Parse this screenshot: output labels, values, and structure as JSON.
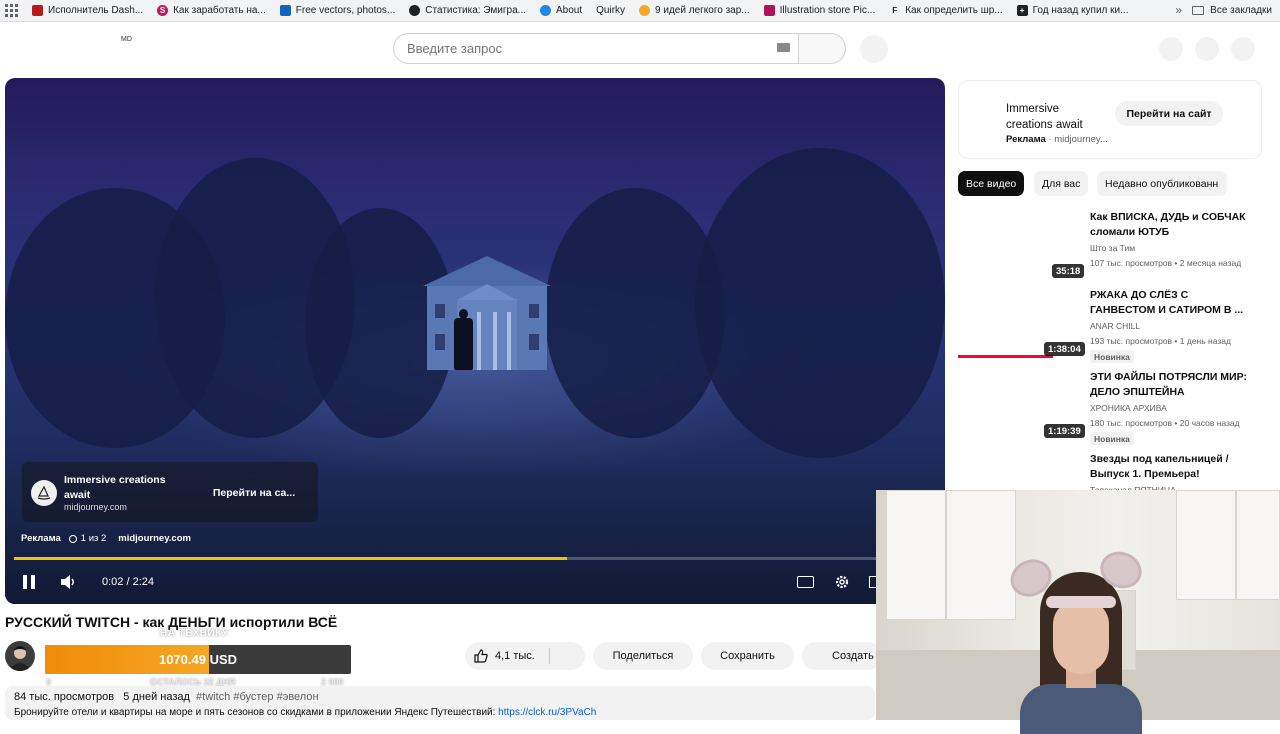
{
  "bookmarks": {
    "items": [
      {
        "label": "Исполнитель Dash...",
        "color": "#b71c1c",
        "glyph": ""
      },
      {
        "label": "Как заработать на...",
        "color": "#c2185b",
        "glyph": "S"
      },
      {
        "label": "Free vectors, photos...",
        "color": "#1565c0",
        "glyph": ""
      },
      {
        "label": "Статистика: Эмигра...",
        "color": "#202124",
        "glyph": ""
      },
      {
        "label": "About",
        "color": "#1e88e5",
        "glyph": ""
      },
      {
        "label": "Quirky",
        "color": "#ffffff",
        "glyph": ""
      },
      {
        "label": "9 идей легкого зар...",
        "color": "#f9a825",
        "glyph": ""
      },
      {
        "label": "Illustration store Pic...",
        "color": "#ad1457",
        "glyph": ""
      },
      {
        "label": "Как определить шр...",
        "color": "#ffffff",
        "glyph": "F"
      },
      {
        "label": "Год назад купил ки...",
        "color": "#202124",
        "glyph": "+"
      }
    ],
    "more": "»",
    "all_bookmarks": "Все закладки"
  },
  "header": {
    "logo_text": "MD",
    "search_placeholder": "Введите запрос"
  },
  "player": {
    "ad_title": "Immersive creations await",
    "ad_domain": "midjourney.com",
    "ad_cta": "Перейти на са...",
    "ad_label": "Реклама",
    "ad_count": "1 из 2",
    "ad_site": "midjourney.com",
    "time": "0:02 / 2:24",
    "progress": 0.6
  },
  "video": {
    "title": "РУССКИЙ TWITCH - как ДЕНЬГИ испортили ВСЁ",
    "donation_label": "НА ТЕХНИКУ",
    "donation_amount": "1070.49 USD",
    "donation_progress": 0.535,
    "donation_min": "0",
    "donation_remaining": "ОСТАЛОСЬ 22 ДНЯ",
    "donation_max": "2 000",
    "likes": "4,1 тыс.",
    "share": "Поделиться",
    "save": "Сохранить",
    "create": "Создать",
    "views": "84 тыс. просмотров",
    "date": "5 дней назад",
    "tags": "#twitch #бустер #эвелон",
    "desc_text": "Бронируйте отели и квартиры на море и пять сезонов со скидками в приложении Яндекс Путешествий: ",
    "desc_link": "https://clck.ru/3PVaCh"
  },
  "sidebar": {
    "ad": {
      "title": "Immersive creations await",
      "label": "Реклама",
      "domain": "midjourney...",
      "cta": "Перейти на сайт"
    },
    "chips": [
      "Все видео",
      "Для вас",
      "Недавно опубликованн"
    ],
    "videos": [
      {
        "title": "Как ВПИСКА, ДУДЬ и СОБЧАК сломали ЮТУБ",
        "channel": "Што за Тим",
        "meta": "107 тыс. просмотров • 2 месяца назад",
        "duration": "35:18",
        "badge": ""
      },
      {
        "title": "РЖАКА ДО СЛЁЗ С ГАНВЕСТОМ И САТИРОМ В ...",
        "channel": "ANAR CHILL",
        "meta": "193 тыс. просмотров • 1 день назад",
        "duration": "1:38:04",
        "badge": "Новинка"
      },
      {
        "title": "ЭТИ ФАЙЛЫ ПОТРЯСЛИ МИР: ДЕЛО ЭПШТЕЙНА",
        "channel": "ХРОНИКА АРХИВА",
        "meta": "180 тыс. просмотров • 20 часов назад",
        "duration": "1:19:39",
        "badge": "Новинка"
      },
      {
        "title": "Звезды под капельницей / Выпуск 1. Премьера!",
        "channel": "Телеканал ПЯТНИЦА",
        "meta": "",
        "duration": "",
        "badge": ""
      }
    ]
  }
}
